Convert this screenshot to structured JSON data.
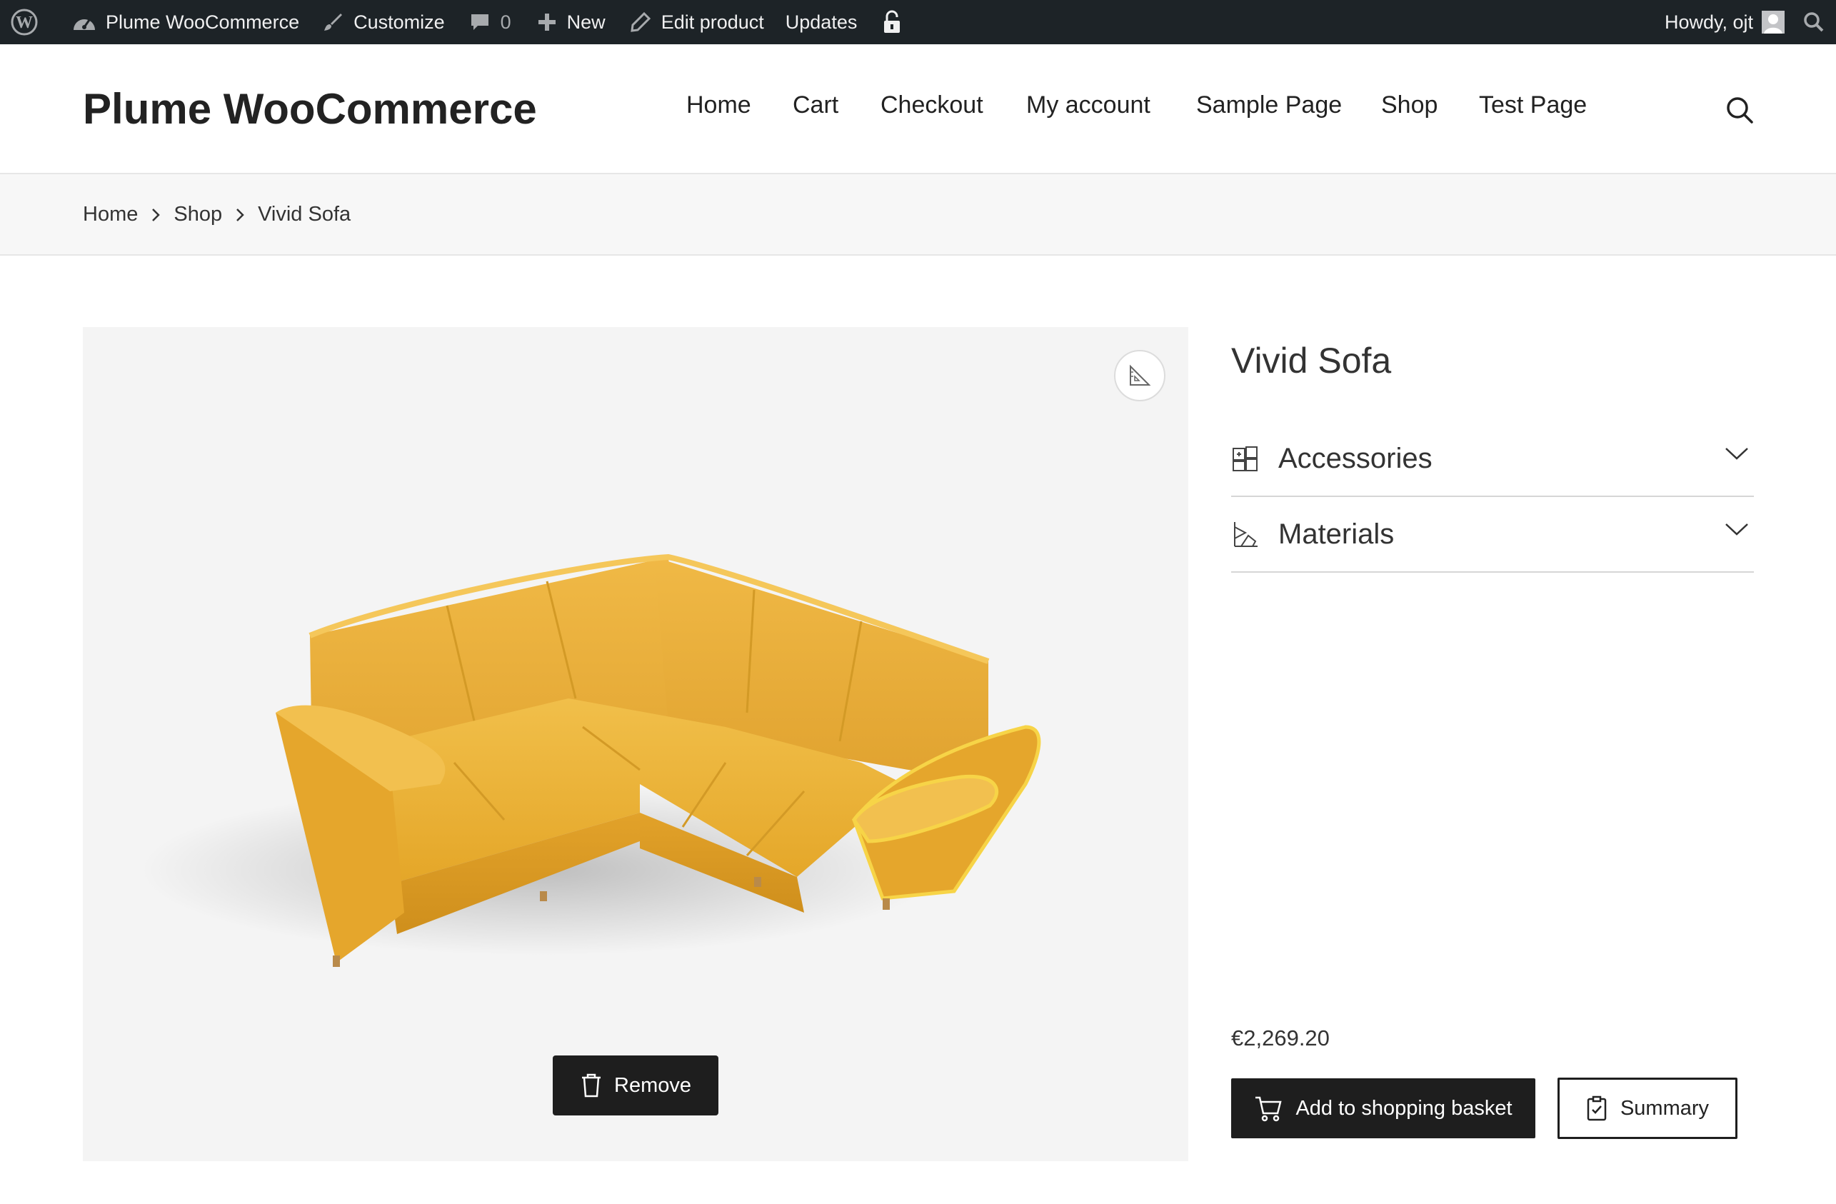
{
  "adminbar": {
    "wp_logo_icon": "wordpress-icon",
    "site_name": "Plume WooCommerce",
    "customize": "Customize",
    "comments_count": "0",
    "new": "New",
    "edit_product": "Edit product",
    "updates": "Updates",
    "howdy": "Howdy, ojt"
  },
  "header": {
    "site_title": "Plume WooCommerce",
    "nav": [
      "Home",
      "Cart",
      "Checkout",
      "My account",
      "Sample Page",
      "Shop",
      "Test Page"
    ]
  },
  "breadcrumb": [
    "Home",
    "Shop",
    "Vivid Sofa"
  ],
  "viewer": {
    "remove_label": "Remove",
    "sofa_color": "#e9ae34"
  },
  "product": {
    "title": "Vivid Sofa",
    "accordions": [
      {
        "label": "Accessories",
        "icon": "accessories-icon"
      },
      {
        "label": "Materials",
        "icon": "materials-icon"
      }
    ],
    "price": "€2,269.20",
    "add_to_basket": "Add to shopping basket",
    "summary": "Summary"
  }
}
